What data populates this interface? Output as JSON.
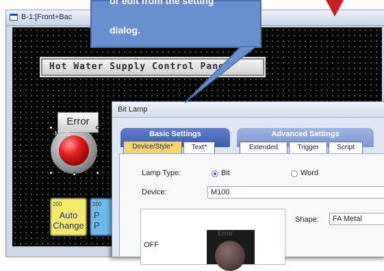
{
  "window": {
    "title": "B-1:[Front+Bac"
  },
  "callout": {
    "line1": "or edit from the setting",
    "line2": "dialog."
  },
  "canvas": {
    "panel_title": "Hot Water Supply Control Panel",
    "lamp": {
      "label": "Error",
      "device": "M100"
    },
    "buttons": [
      {
        "num": "200",
        "line1": "Auto",
        "line2": "Change"
      },
      {
        "num": "200",
        "line1": "P",
        "line2": "P"
      }
    ]
  },
  "dialog": {
    "title": "Bit Lamp",
    "groups": [
      "Basic Settings",
      "Advanced Settings"
    ],
    "tabs": [
      "Device/Style*",
      "Text*",
      "Extended",
      "Trigger",
      "Script"
    ],
    "lamp_type_label": "Lamp Type:",
    "lamp_type_options": [
      "Bit",
      "Word"
    ],
    "lamp_type_selected": "Bit",
    "device_label": "Device:",
    "device_value": "M100",
    "shape_label": "Shape:",
    "shape_value": "FA Metal",
    "preview_state": "OFF",
    "preview_text": "Error"
  },
  "colors": {
    "callout": "#6a8fce",
    "arrow": "#cc1e1e",
    "lamp_on": "#e52121",
    "tab_selected": "#f4d56a"
  }
}
